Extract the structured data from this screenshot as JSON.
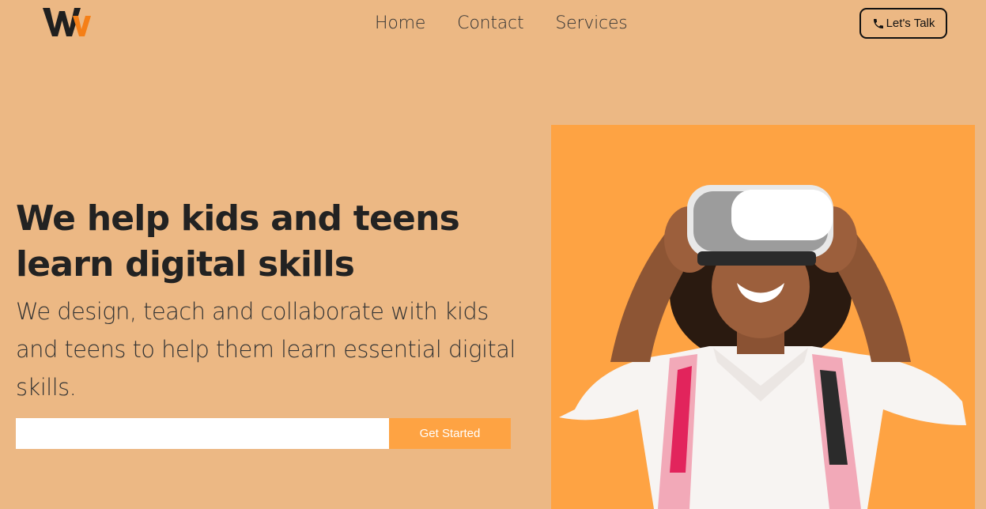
{
  "header": {
    "logo_alt": "W",
    "nav": [
      {
        "label": "Home"
      },
      {
        "label": "Contact"
      },
      {
        "label": "Services"
      }
    ],
    "cta_label": "Let's Talk"
  },
  "hero": {
    "headline": "We help kids and teens learn digital skills",
    "subtext": "We design, teach and collaborate with kids and teens to help them learn essential digital skills.",
    "email_placeholder": "",
    "button_label": "Get Started",
    "image_subject": "girl-wearing-vr-headset"
  },
  "colors": {
    "background": "#ecb884",
    "accent": "#fea343",
    "text": "#222222"
  }
}
